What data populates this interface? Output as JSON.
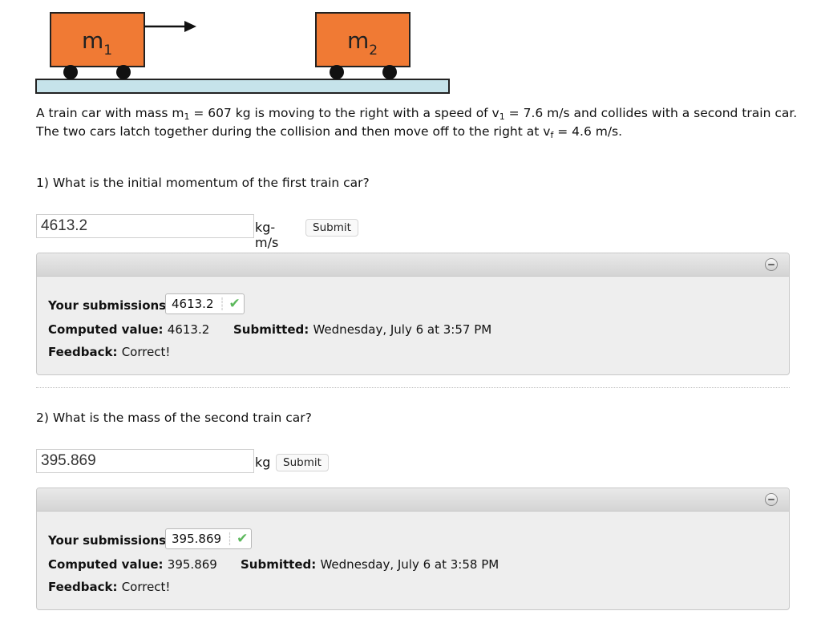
{
  "diagram": {
    "car1_label": "m",
    "car1_sub": "1",
    "car2_label": "m",
    "car2_sub": "2",
    "car_color": "#f07a34",
    "track_color": "#c6e3ea"
  },
  "problem": {
    "part1": "A train car with mass m",
    "m_sub": "1",
    "part2": " = 607 kg is moving to the right with a speed of v",
    "v_sub": "1",
    "part3": " = 7.6 m/s and collides with a second train car. The two cars latch together during the collision and then move off to the right at v",
    "vf_sub": "f",
    "part4": " = 4.6 m/s."
  },
  "questions": [
    {
      "text": "1) What is the initial momentum of the first train car?",
      "input_value": "4613.2",
      "unit": "kg-m/s",
      "submit_label": "Submit",
      "submissions_label": "Your submissions:",
      "submission_value": "4613.2",
      "computed_label": "Computed value:",
      "computed_value": "4613.2",
      "submitted_label": "Submitted:",
      "submitted_value": "Wednesday, July 6 at 3:57 PM",
      "feedback_label": "Feedback:",
      "feedback_value": "Correct!"
    },
    {
      "text": "2) What is the mass of the second train car?",
      "input_value": "395.869",
      "unit": "kg",
      "submit_label": "Submit",
      "submissions_label": "Your submissions:",
      "submission_value": "395.869",
      "computed_label": "Computed value:",
      "computed_value": "395.869",
      "submitted_label": "Submitted:",
      "submitted_value": "Wednesday, July 6 at 3:58 PM",
      "feedback_label": "Feedback:",
      "feedback_value": "Correct!"
    }
  ],
  "icons": {
    "check": "checkmark-icon",
    "collapse": "collapse-icon",
    "arrow": "right-arrow-icon"
  },
  "colors": {
    "check_green": "#5cb85c"
  }
}
